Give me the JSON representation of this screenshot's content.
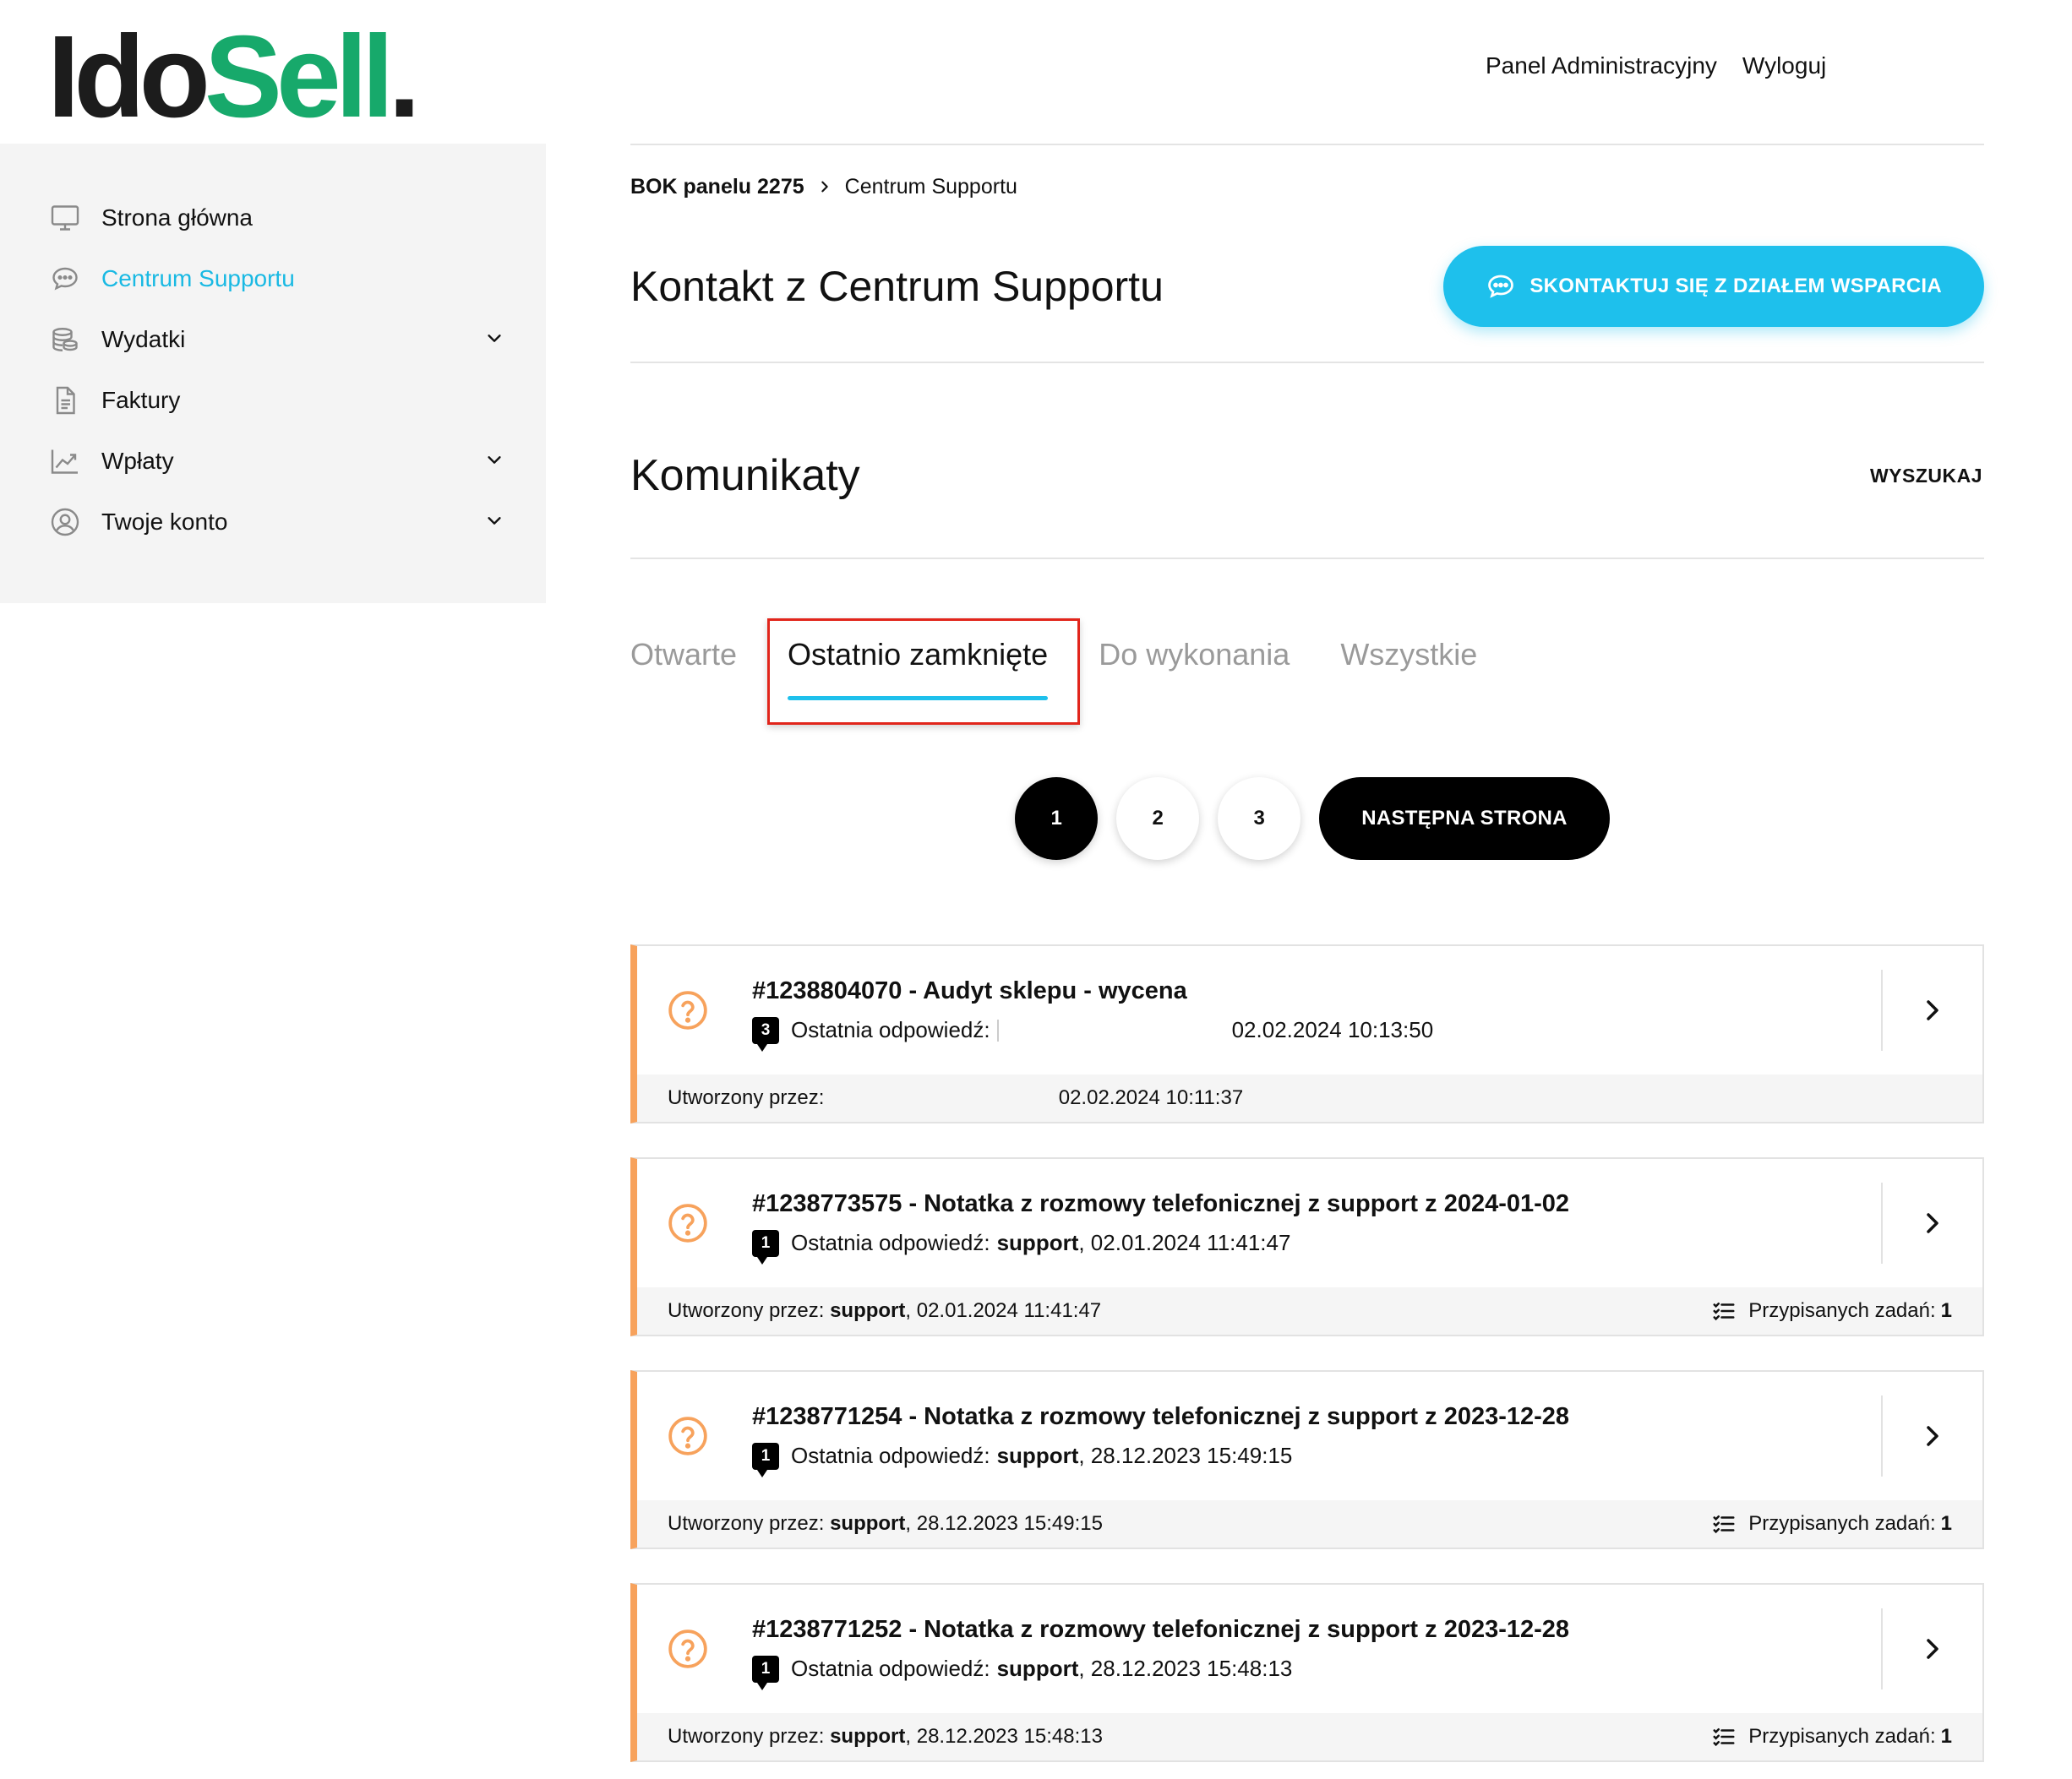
{
  "brand": {
    "logo_part1": "Ido",
    "logo_part2": "Sell",
    "logo_dot": ".",
    "accent": "#17a96b",
    "highlight": "#1ec0ec"
  },
  "topnav": {
    "admin_panel": "Panel Administracyjny",
    "logout": "Wyloguj"
  },
  "sidebar": {
    "items": [
      {
        "label": "Strona główna",
        "icon": "monitor-icon",
        "active": false,
        "expandable": false
      },
      {
        "label": "Centrum Supportu",
        "icon": "chat-icon",
        "active": true,
        "expandable": false
      },
      {
        "label": "Wydatki",
        "icon": "coins-icon",
        "active": false,
        "expandable": true
      },
      {
        "label": "Faktury",
        "icon": "document-icon",
        "active": false,
        "expandable": false
      },
      {
        "label": "Wpłaty",
        "icon": "chart-icon",
        "active": false,
        "expandable": true
      },
      {
        "label": "Twoje konto",
        "icon": "user-icon",
        "active": false,
        "expandable": true
      }
    ]
  },
  "breadcrumb": {
    "root": "BOK panelu 2275",
    "current": "Centrum Supportu"
  },
  "page": {
    "title": "Kontakt z Centrum Supportu",
    "contact_button": "SKONTAKTUJ SIĘ Z DZIAŁEM WSPARCIA"
  },
  "messages": {
    "title": "Komunikaty",
    "search": "WYSZUKAJ",
    "tabs": [
      {
        "label": "Otwarte",
        "active": false
      },
      {
        "label": "Ostatnio zamknięte",
        "active": true
      },
      {
        "label": "Do wykonania",
        "active": false
      },
      {
        "label": "Wszystkie",
        "active": false
      }
    ]
  },
  "pagination": {
    "pages": [
      "1",
      "2",
      "3"
    ],
    "current": "1",
    "next": "NASTĘPNA STRONA"
  },
  "tickets": [
    {
      "title": "#1238804070 - Audyt sklepu - wycena",
      "reply_count": "3",
      "reply_label": "Ostatnia odpowiedź:",
      "reply_author": "",
      "reply_date": "02.02.2024 10:13:50",
      "created_label": "Utworzony przez:",
      "created_author": "",
      "created_date": "02.02.2024 10:11:37",
      "tasks_label": "",
      "tasks_count": ""
    },
    {
      "title": "#1238773575 - Notatka z rozmowy telefonicznej z support z 2024-01-02",
      "reply_count": "1",
      "reply_label": "Ostatnia odpowiedź:",
      "reply_author": "support",
      "reply_date": ", 02.01.2024 11:41:47",
      "created_label": "Utworzony przez:",
      "created_author": "support",
      "created_date": ", 02.01.2024 11:41:47",
      "tasks_label": "Przypisanych zadań:",
      "tasks_count": "1"
    },
    {
      "title": "#1238771254 - Notatka z rozmowy telefonicznej z support z 2023-12-28",
      "reply_count": "1",
      "reply_label": "Ostatnia odpowiedź:",
      "reply_author": "support",
      "reply_date": ", 28.12.2023 15:49:15",
      "created_label": "Utworzony przez:",
      "created_author": "support",
      "created_date": ", 28.12.2023 15:49:15",
      "tasks_label": "Przypisanych zadań:",
      "tasks_count": "1"
    },
    {
      "title": "#1238771252 - Notatka z rozmowy telefonicznej z support z 2023-12-28",
      "reply_count": "1",
      "reply_label": "Ostatnia odpowiedź:",
      "reply_author": "support",
      "reply_date": ", 28.12.2023 15:48:13",
      "created_label": "Utworzony przez:",
      "created_author": "support",
      "created_date": ", 28.12.2023 15:48:13",
      "tasks_label": "Przypisanych zadań:",
      "tasks_count": "1"
    }
  ],
  "colors": {
    "ticket_border": "#f7a25c",
    "tab_active_underline": "#1ec0ec",
    "highlight_box": "#e1251b"
  }
}
